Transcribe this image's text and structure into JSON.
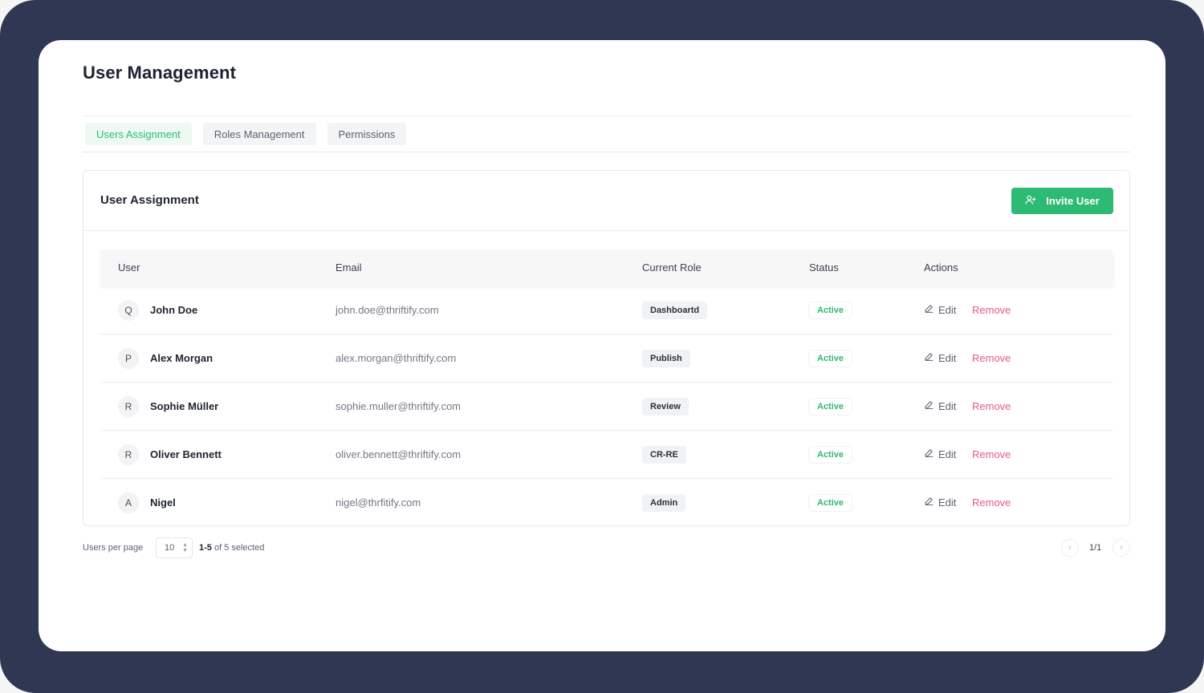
{
  "page": {
    "title": "User Management"
  },
  "tabs": [
    {
      "label": "Users Assignment",
      "active": true
    },
    {
      "label": "Roles Management",
      "active": false
    },
    {
      "label": "Permissions",
      "active": false
    }
  ],
  "card": {
    "title": "User Assignment",
    "invite_label": "Invite User",
    "invite_icon": "user-plus-icon"
  },
  "table": {
    "headers": [
      "User",
      "Email",
      "Current Role",
      "Status",
      "Actions"
    ],
    "rows": [
      {
        "initial": "Q",
        "name": "John Doe",
        "email": "john.doe@thriftify.com",
        "role": "Dashboartd",
        "status": "Active",
        "edit": "Edit",
        "remove": "Remove"
      },
      {
        "initial": "P",
        "name": "Alex Morgan",
        "email": "alex.morgan@thriftify.com",
        "role": "Publish",
        "status": "Active",
        "edit": "Edit",
        "remove": "Remove"
      },
      {
        "initial": "R",
        "name": "Sophie Müller",
        "email": "sophie.muller@thriftify.com",
        "role": "Review",
        "status": "Active",
        "edit": "Edit",
        "remove": "Remove"
      },
      {
        "initial": "R",
        "name": "Oliver Bennett",
        "email": "oliver.bennett@thriftify.com",
        "role": "CR-RE",
        "status": "Active",
        "edit": "Edit",
        "remove": "Remove"
      },
      {
        "initial": "A",
        "name": "Nigel",
        "email": "nigel@thrfitify.com",
        "role": "Admin",
        "status": "Active",
        "edit": "Edit",
        "remove": "Remove"
      }
    ]
  },
  "footer": {
    "per_page_label": "Users per page",
    "per_page_value": "10",
    "range_bold": "1-5",
    "range_rest": " of 5 selected",
    "page_indicator": "1/1",
    "prev_icon": "chevron-left-icon",
    "next_icon": "chevron-right-icon"
  },
  "colors": {
    "background": "#303753",
    "accent": "#2dbb73",
    "danger": "#e6578c"
  }
}
